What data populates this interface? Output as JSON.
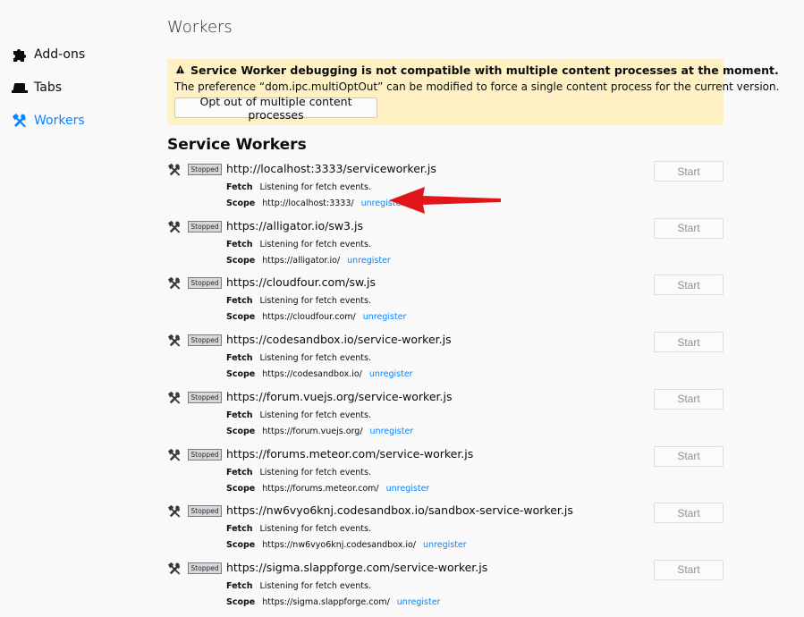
{
  "sidebar": {
    "items": [
      {
        "label": "Add-ons",
        "icon": "puzzle-icon",
        "selected": false
      },
      {
        "label": "Tabs",
        "icon": "tab-icon",
        "selected": false
      },
      {
        "label": "Workers",
        "icon": "workers-tools-icon",
        "selected": true
      }
    ]
  },
  "page_title": "Workers",
  "warning": {
    "icon": "warning-icon",
    "title": "Service Worker debugging is not compatible with multiple content processes at the moment.",
    "body": "The preference “dom.ipc.multiOptOut” can be modified to force a single content process for the current version.",
    "button_label": "Opt out of multiple content processes"
  },
  "section_title": "Service Workers",
  "workers": [
    {
      "status": "Stopped",
      "url": "http://localhost:3333/serviceworker.js",
      "fetch_label": "Fetch",
      "fetch_text": "Listening for fetch events.",
      "scope_label": "Scope",
      "scope": "http://localhost:3333/",
      "unregister": "unregister",
      "start": "Start"
    },
    {
      "status": "Stopped",
      "url": "https://alligator.io/sw3.js",
      "fetch_label": "Fetch",
      "fetch_text": "Listening for fetch events.",
      "scope_label": "Scope",
      "scope": "https://alligator.io/",
      "unregister": "unregister",
      "start": "Start"
    },
    {
      "status": "Stopped",
      "url": "https://cloudfour.com/sw.js",
      "fetch_label": "Fetch",
      "fetch_text": "Listening for fetch events.",
      "scope_label": "Scope",
      "scope": "https://cloudfour.com/",
      "unregister": "unregister",
      "start": "Start"
    },
    {
      "status": "Stopped",
      "url": "https://codesandbox.io/service-worker.js",
      "fetch_label": "Fetch",
      "fetch_text": "Listening for fetch events.",
      "scope_label": "Scope",
      "scope": "https://codesandbox.io/",
      "unregister": "unregister",
      "start": "Start"
    },
    {
      "status": "Stopped",
      "url": "https://forum.vuejs.org/service-worker.js",
      "fetch_label": "Fetch",
      "fetch_text": "Listening for fetch events.",
      "scope_label": "Scope",
      "scope": "https://forum.vuejs.org/",
      "unregister": "unregister",
      "start": "Start"
    },
    {
      "status": "Stopped",
      "url": "https://forums.meteor.com/service-worker.js",
      "fetch_label": "Fetch",
      "fetch_text": "Listening for fetch events.",
      "scope_label": "Scope",
      "scope": "https://forums.meteor.com/",
      "unregister": "unregister",
      "start": "Start"
    },
    {
      "status": "Stopped",
      "url": "https://nw6vyo6knj.codesandbox.io/sandbox-service-worker.js",
      "fetch_label": "Fetch",
      "fetch_text": "Listening for fetch events.",
      "scope_label": "Scope",
      "scope": "https://nw6vyo6knj.codesandbox.io/",
      "unregister": "unregister",
      "start": "Start"
    },
    {
      "status": "Stopped",
      "url": "https://sigma.slappforge.com/service-worker.js",
      "fetch_label": "Fetch",
      "fetch_text": "Listening for fetch events.",
      "scope_label": "Scope",
      "scope": "https://sigma.slappforge.com/",
      "unregister": "unregister",
      "start": "Start"
    }
  ],
  "annotation": {
    "icon": "red-arrow-icon",
    "color": "#e0161b"
  },
  "colors": {
    "accent": "#0a84ff",
    "warning_bg": "#fff1c4",
    "status_bg": "#d7d7db"
  }
}
